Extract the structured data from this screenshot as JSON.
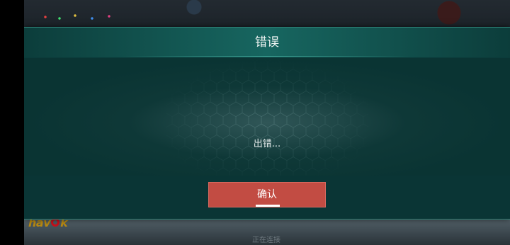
{
  "dialog": {
    "title": "错误",
    "message": "出错...",
    "confirm_label": "确认"
  },
  "footer_hint": "正在连接",
  "logo": {
    "text_a": "hav",
    "text_b": "k"
  },
  "colors": {
    "dialog_bg": "#0b3b3a",
    "header_accent": "#176660",
    "confirm_button": "#c24c43",
    "logo": "#b98a12"
  }
}
